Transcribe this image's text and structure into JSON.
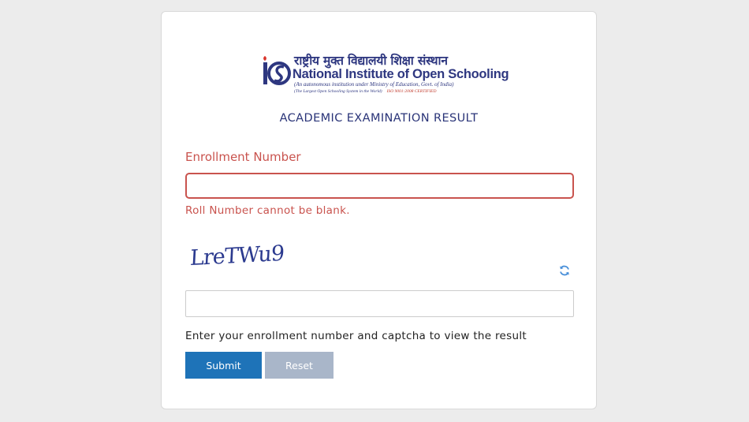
{
  "logo": {
    "hindi_name": "राष्ट्रीय मुक्त विद्यालयी शिक्षा संस्थान",
    "english_name_part1": "National Institute of ",
    "english_name_part2": "Open Schooling",
    "subtitle": "(An autonomous institution under Ministry of Education, Govt. of India)",
    "tagline": "(The Largest Open Schooling System in the World)",
    "iso": "ISO 9001:2008 CERTIFIED",
    "icon": "nios-logo-icon",
    "brand_color": "#2e3780",
    "accent_color": "#c0392b"
  },
  "page": {
    "title": "ACADEMIC EXAMINATION RESULT"
  },
  "form": {
    "enrollment_label": "Enrollment Number",
    "enrollment_value": "",
    "enrollment_placeholder": "",
    "error_message": "Roll Number cannot be blank.",
    "error_color": "#c9534e",
    "captcha_text": "LreTWu9",
    "refresh_icon": "refresh-icon",
    "captcha_value": "",
    "captcha_placeholder": "",
    "hint": "Enter your enrollment number and captcha to view the result",
    "submit_label": "Submit",
    "reset_label": "Reset",
    "submit_color": "#1e73b8",
    "reset_color": "#a9b6c9"
  }
}
